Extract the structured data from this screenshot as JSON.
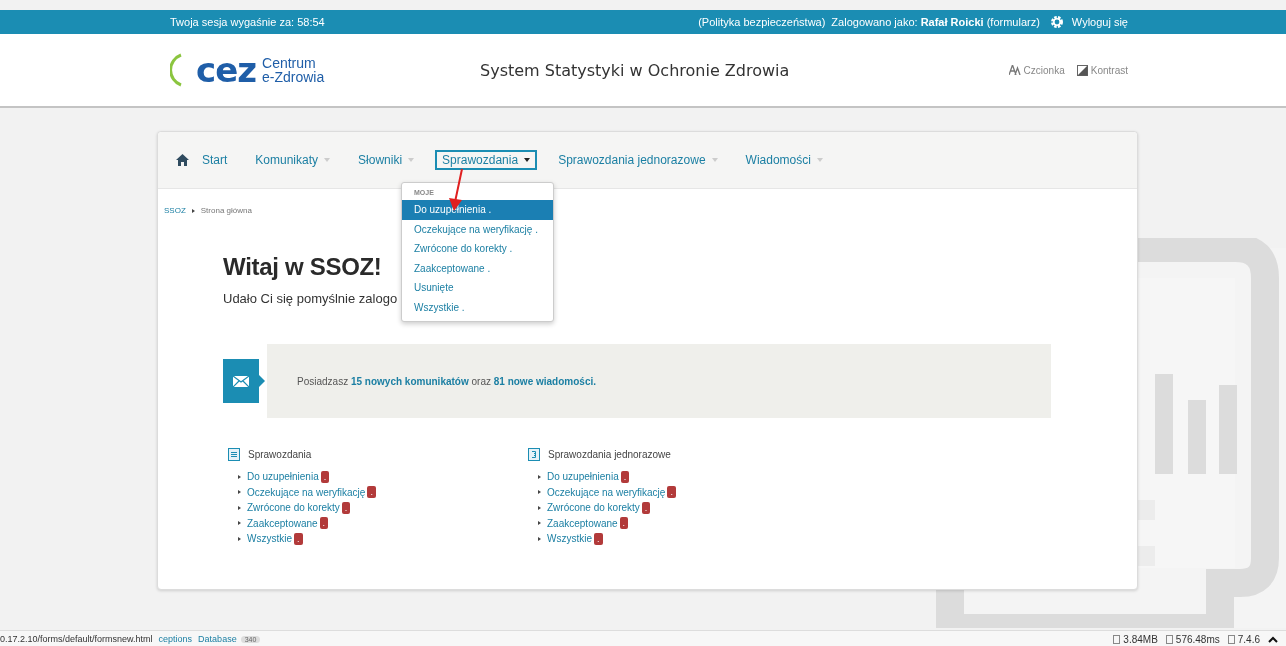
{
  "session_bar": {
    "session": "Twoja sesja wygaśnie za: 58:54",
    "policy_link": "(Polityka bezpieczeństwa)",
    "logged_as_label": "Zalogowano jako:",
    "user": "Rafał Roicki",
    "role": "(formularz)",
    "logout": "Wyloguj się"
  },
  "header": {
    "logo_mark": "cez",
    "logo_line1": "Centrum",
    "logo_line2": "e-Zdrowia",
    "title": "System Statystyki w Ochronie Zdrowia",
    "font_button": "Czcionka",
    "contrast_button": "Kontrast"
  },
  "nav": [
    {
      "label": "Start",
      "kind": "home",
      "selected": false
    },
    {
      "label": "Komunikaty",
      "kind": "dropdown",
      "selected": false
    },
    {
      "label": "Słowniki",
      "kind": "dropdown",
      "selected": false
    },
    {
      "label": "Sprawozdania",
      "kind": "dropdown",
      "selected": true
    },
    {
      "label": "Sprawozdania jednorazowe",
      "kind": "dropdown",
      "selected": false
    },
    {
      "label": "Wiadomości",
      "kind": "dropdown",
      "selected": false
    }
  ],
  "dropdown": {
    "section": "MOJE",
    "items": [
      {
        "label": "Do uzupełnienia .",
        "selected": true
      },
      {
        "label": "Oczekujące na weryfikację .",
        "selected": false
      },
      {
        "label": "Zwrócone do korekty .",
        "selected": false
      },
      {
        "label": "Zaakceptowane .",
        "selected": false
      },
      {
        "label": "Usunięte",
        "selected": false
      },
      {
        "label": "Wszystkie .",
        "selected": false
      }
    ]
  },
  "breadcrumb": [
    "SSOZ",
    "Strona główna"
  ],
  "welcome": {
    "title": "Witaj w SSOZ!",
    "subtitle": "Udało Ci się pomyślnie zalogo"
  },
  "notice": {
    "prefix": "Posiadzasz ",
    "link1": "15 nowych komunikatów",
    "middle": " oraz ",
    "link2": "81 nowe wiadomości."
  },
  "lists": [
    {
      "title": "Sprawozdania",
      "kind": "doc",
      "items": [
        {
          "label": "Do uzupełnienia",
          "badge": "."
        },
        {
          "label": "Oczekujące na weryfikację",
          "badge": "."
        },
        {
          "label": "Zwrócone do korekty",
          "badge": "."
        },
        {
          "label": "Zaakceptowane",
          "badge": "."
        },
        {
          "label": "Wszystkie",
          "badge": "."
        }
      ]
    },
    {
      "title": "Sprawozdania jednorazowe",
      "kind": "doc-arrow",
      "items": [
        {
          "label": "Do uzupełnienia",
          "badge": "."
        },
        {
          "label": "Oczekujące na weryfikację",
          "badge": "."
        },
        {
          "label": "Zwrócone do korekty",
          "badge": "."
        },
        {
          "label": "Zaakceptowane",
          "badge": "."
        },
        {
          "label": "Wszystkie",
          "badge": "."
        }
      ]
    }
  ],
  "debug_bar": {
    "url": "0.17.2.10/forms/default/formsnew.html",
    "tabs": [
      {
        "label": "ceptions"
      },
      {
        "label": "Database",
        "count": "340"
      }
    ],
    "stats": [
      "3.84MB",
      "576.48ms",
      "7.4.6"
    ]
  }
}
